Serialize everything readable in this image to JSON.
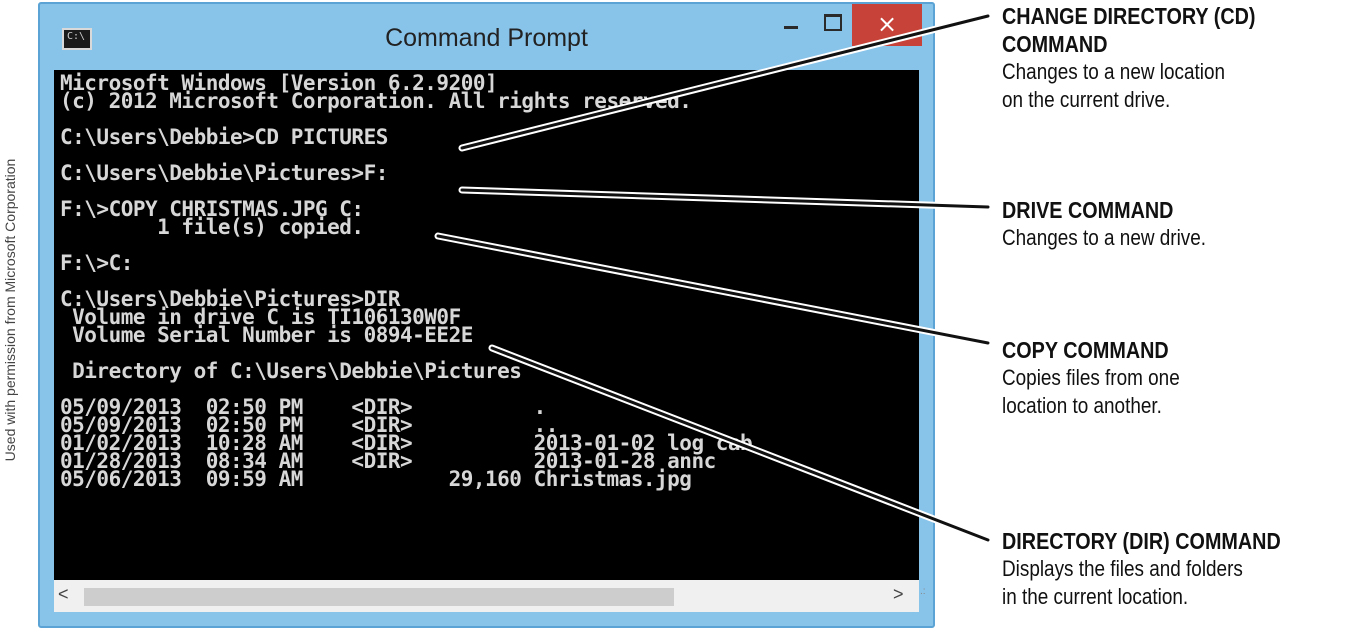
{
  "credit": "Used with permission from Microsoft Corporation",
  "window": {
    "title": "Command Prompt",
    "icon": "cmd-icon",
    "icon_text": "C:\\",
    "close_glyph": "×"
  },
  "console_lines": [
    "Microsoft Windows [Version 6.2.9200]",
    "(c) 2012 Microsoft Corporation. All rights reserved.",
    "",
    "C:\\Users\\Debbie>CD PICTURES",
    "",
    "C:\\Users\\Debbie\\Pictures>F:",
    "",
    "F:\\>COPY CHRISTMAS.JPG C:",
    "        1 file(s) copied.",
    "",
    "F:\\>C:",
    "",
    "C:\\Users\\Debbie\\Pictures>DIR",
    " Volume in drive C is TI106130W0F",
    " Volume Serial Number is 0894-EE2E",
    "",
    " Directory of C:\\Users\\Debbie\\Pictures",
    "",
    "05/09/2013  02:50 PM    <DIR>          .",
    "05/09/2013  02:50 PM    <DIR>          ..",
    "01/02/2013  10:28 AM    <DIR>          2013-01-02 log cab",
    "01/28/2013  08:34 AM    <DIR>          2013-01-28 annc",
    "05/06/2013  09:59 AM            29,160 Christmas.jpg"
  ],
  "callouts": [
    {
      "head": [
        "CHANGE DIRECTORY (CD)",
        "COMMAND"
      ],
      "desc": [
        "Changes to a new location",
        "on the current drive."
      ]
    },
    {
      "head": [
        "DRIVE COMMAND"
      ],
      "desc": [
        "Changes to a new drive."
      ]
    },
    {
      "head": [
        "COPY COMMAND"
      ],
      "desc": [
        "Copies files from one",
        "location to another."
      ]
    },
    {
      "head": [
        "DIRECTORY (DIR) COMMAND"
      ],
      "desc": [
        "Displays the files and folders",
        "in the current location."
      ]
    }
  ]
}
